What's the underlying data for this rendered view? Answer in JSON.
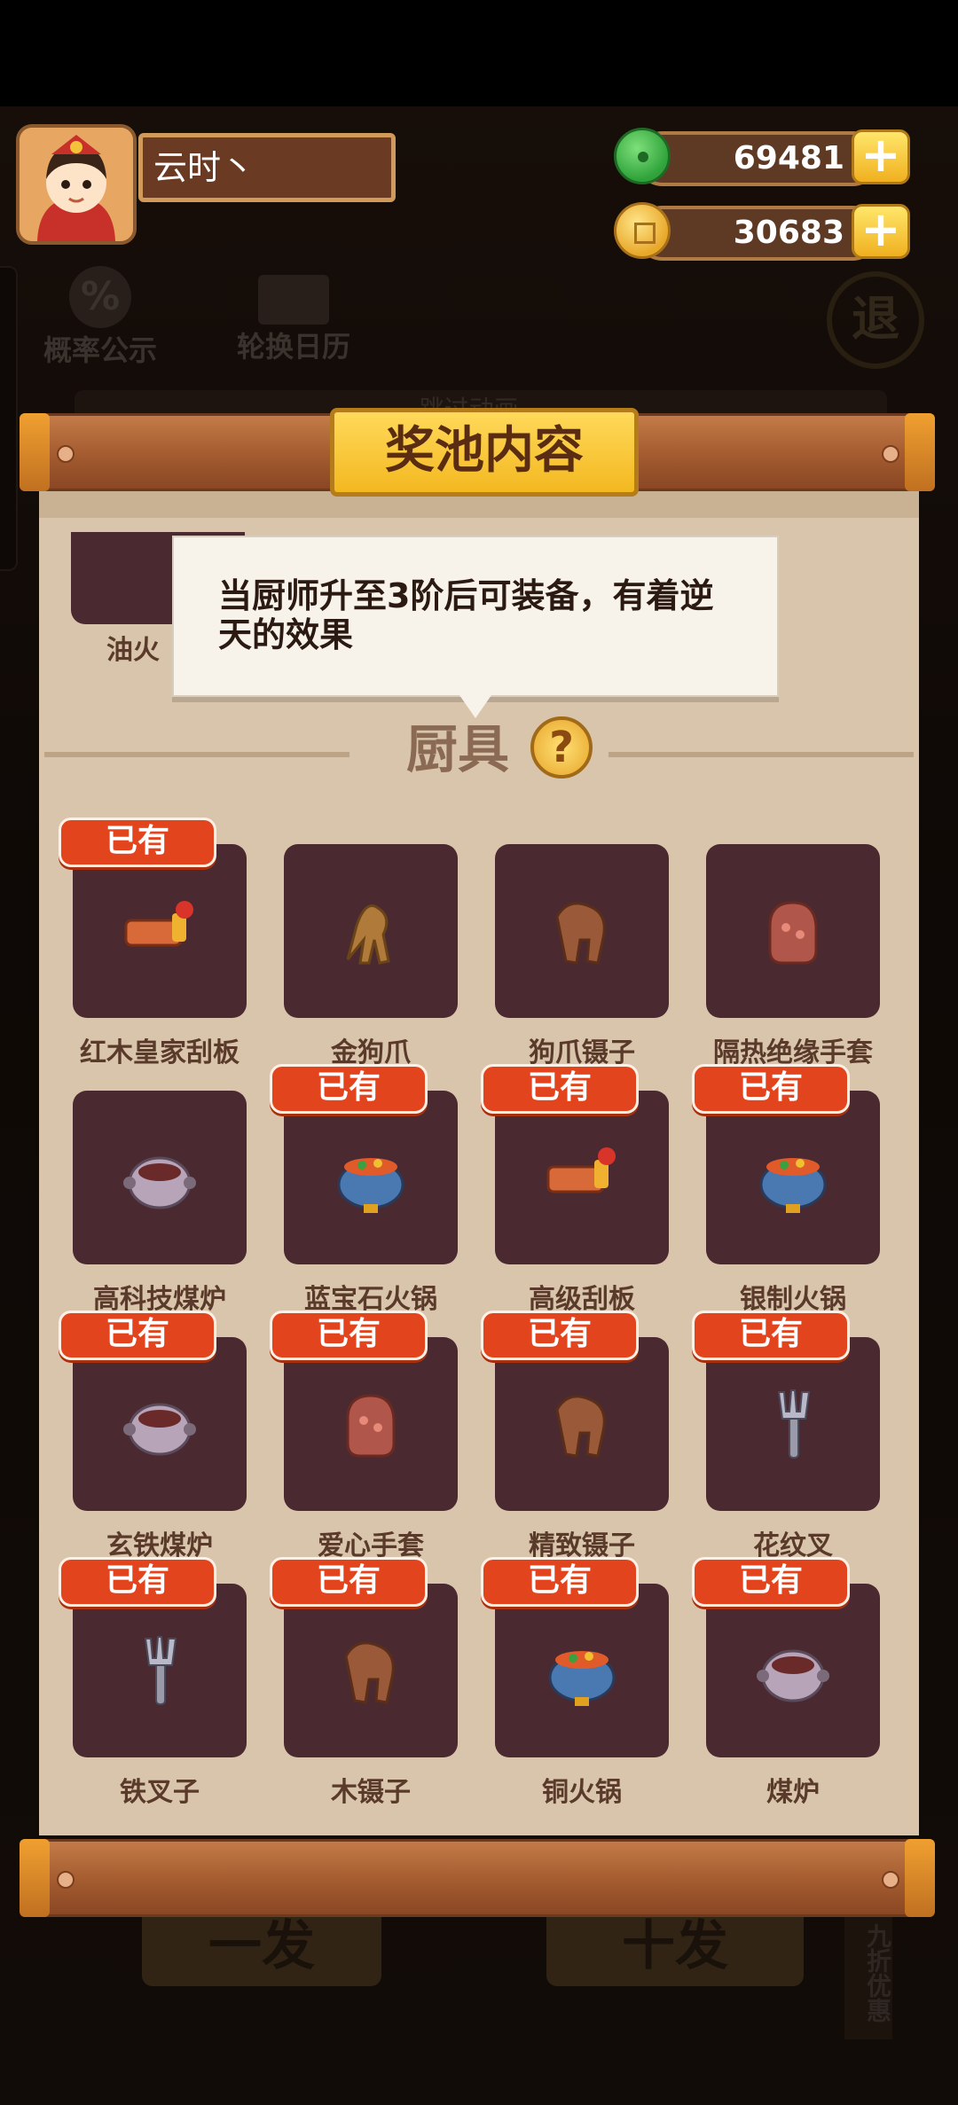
{
  "player": {
    "name": "云时丶"
  },
  "currencies": [
    {
      "name": "jade",
      "value": "69481",
      "color": "#39b34a"
    },
    {
      "name": "coin",
      "value": "30683",
      "color": "#f2c23a"
    }
  ],
  "background": {
    "prob_label": "概率公示",
    "calendar_label": "轮换日历",
    "exit_label": "退",
    "one_draw": "一发",
    "ten_draw": "十发",
    "discount": "九折优惠",
    "behind_hint": "跳过动画..."
  },
  "panel": {
    "title": "奖池内容",
    "tooltip": "当厨师升至3阶后可装备，有着逆天的效果",
    "partial_item": "油火",
    "section_title": "厨具",
    "help_icon": "?"
  },
  "owned_label": "已有",
  "items": [
    {
      "name": "红木皇家刮板",
      "owned": true,
      "icon": "scraper-icon"
    },
    {
      "name": "金狗爪",
      "owned": false,
      "icon": "claw-icon"
    },
    {
      "name": "狗爪镊子",
      "owned": false,
      "icon": "tongs-icon"
    },
    {
      "name": "隔热绝缘手套",
      "owned": false,
      "icon": "mitt-icon"
    },
    {
      "name": "高科技煤炉",
      "owned": false,
      "icon": "stove-icon"
    },
    {
      "name": "蓝宝石火锅",
      "owned": true,
      "icon": "hotpot-icon"
    },
    {
      "name": "高级刮板",
      "owned": true,
      "icon": "scraper-icon"
    },
    {
      "name": "银制火锅",
      "owned": true,
      "icon": "hotpot-icon"
    },
    {
      "name": "玄铁煤炉",
      "owned": true,
      "icon": "stove-icon"
    },
    {
      "name": "爱心手套",
      "owned": true,
      "icon": "mitt-icon"
    },
    {
      "name": "精致镊子",
      "owned": true,
      "icon": "tongs-icon"
    },
    {
      "name": "花纹叉",
      "owned": true,
      "icon": "fork-icon"
    },
    {
      "name": "铁叉子",
      "owned": true,
      "icon": "fork-icon"
    },
    {
      "name": "木镊子",
      "owned": true,
      "icon": "tongs-icon"
    },
    {
      "name": "铜火锅",
      "owned": true,
      "icon": "hotpot-icon"
    },
    {
      "name": "煤炉",
      "owned": true,
      "icon": "stove-icon"
    }
  ]
}
